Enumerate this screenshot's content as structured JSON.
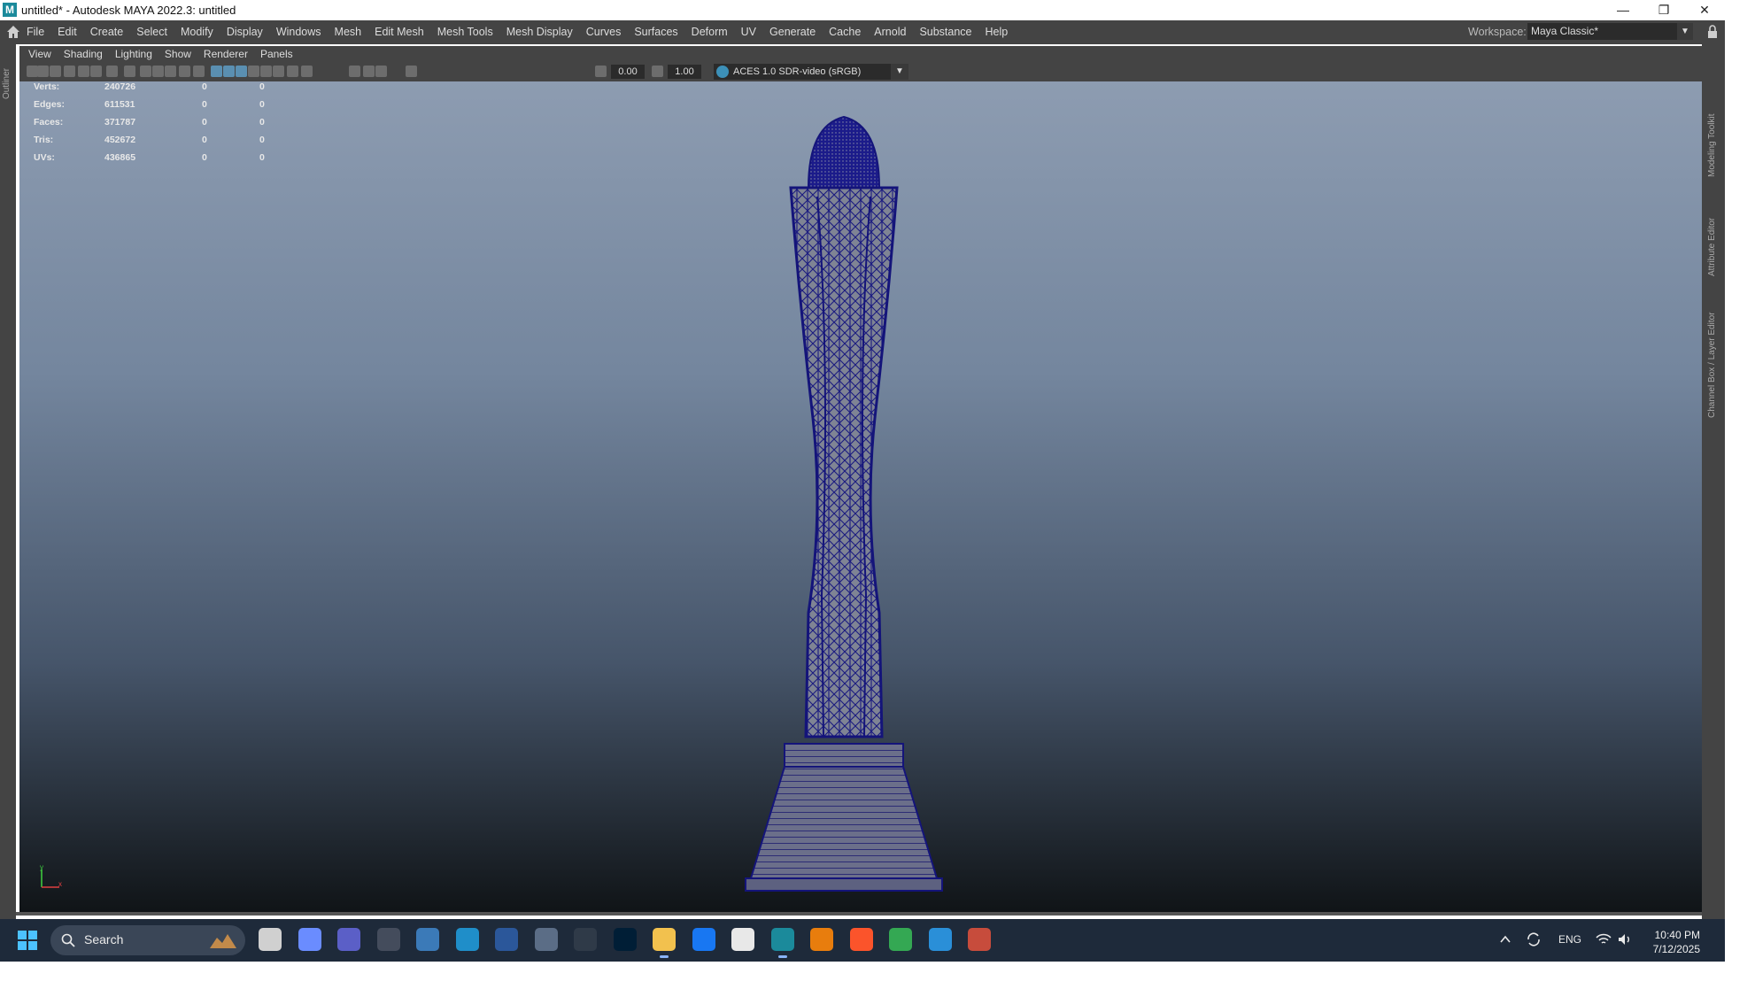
{
  "window": {
    "title": "untitled* - Autodesk MAYA 2022.3: untitled",
    "app_icon_letter": "M",
    "minimize": "—",
    "restore": "❐",
    "close": "✕"
  },
  "menubar": {
    "items": [
      "File",
      "Edit",
      "Create",
      "Select",
      "Modify",
      "Display",
      "Windows",
      "Mesh",
      "Edit Mesh",
      "Mesh Tools",
      "Mesh Display",
      "Curves",
      "Surfaces",
      "Deform",
      "UV",
      "Generate",
      "Cache",
      "Arnold",
      "Substance",
      "Help"
    ],
    "workspace_label": "Workspace:",
    "workspace_value": "Maya Classic*"
  },
  "side_tabs": {
    "left": "Outliner",
    "right": [
      "Modeling Toolkit",
      "Attribute Editor",
      "Channel Box / Layer Editor"
    ]
  },
  "panel_menu": [
    "View",
    "Shading",
    "Lighting",
    "Show",
    "Renderer",
    "Panels"
  ],
  "view_toolbar": {
    "exposure": "0.00",
    "gamma": "1.00",
    "color_space": "ACES 1.0 SDR-video (sRGB)"
  },
  "hud": [
    {
      "label": "Verts:",
      "v1": "240726",
      "v2": "0",
      "v3": "0"
    },
    {
      "label": "Edges:",
      "v1": "611531",
      "v2": "0",
      "v3": "0"
    },
    {
      "label": "Faces:",
      "v1": "371787",
      "v2": "0",
      "v3": "0"
    },
    {
      "label": "Tris:",
      "v1": "452672",
      "v2": "0",
      "v3": "0"
    },
    {
      "label": "UVs:",
      "v1": "436865",
      "v2": "0",
      "v3": "0"
    }
  ],
  "axis": {
    "y": "y",
    "x": "x"
  },
  "taskbar": {
    "search_placeholder": "Search",
    "apps": [
      "task-view",
      "copilot",
      "teams",
      "news",
      "calculator",
      "edge",
      "word",
      "notepad",
      "camera",
      "photoshop",
      "file-explorer",
      "messenger",
      "unity",
      "maya",
      "blender",
      "brave",
      "chrome",
      "browser",
      "3d-app"
    ],
    "tray": {
      "language": "ENG",
      "time": "10:40 PM",
      "date": "7/12/2025"
    }
  },
  "colors": {
    "ui_dark": "#444444",
    "viewport_top": "#8d9cb1",
    "viewport_bottom": "#101417",
    "wireframe": "#14147a",
    "taskbar": "#1e2a3a"
  }
}
